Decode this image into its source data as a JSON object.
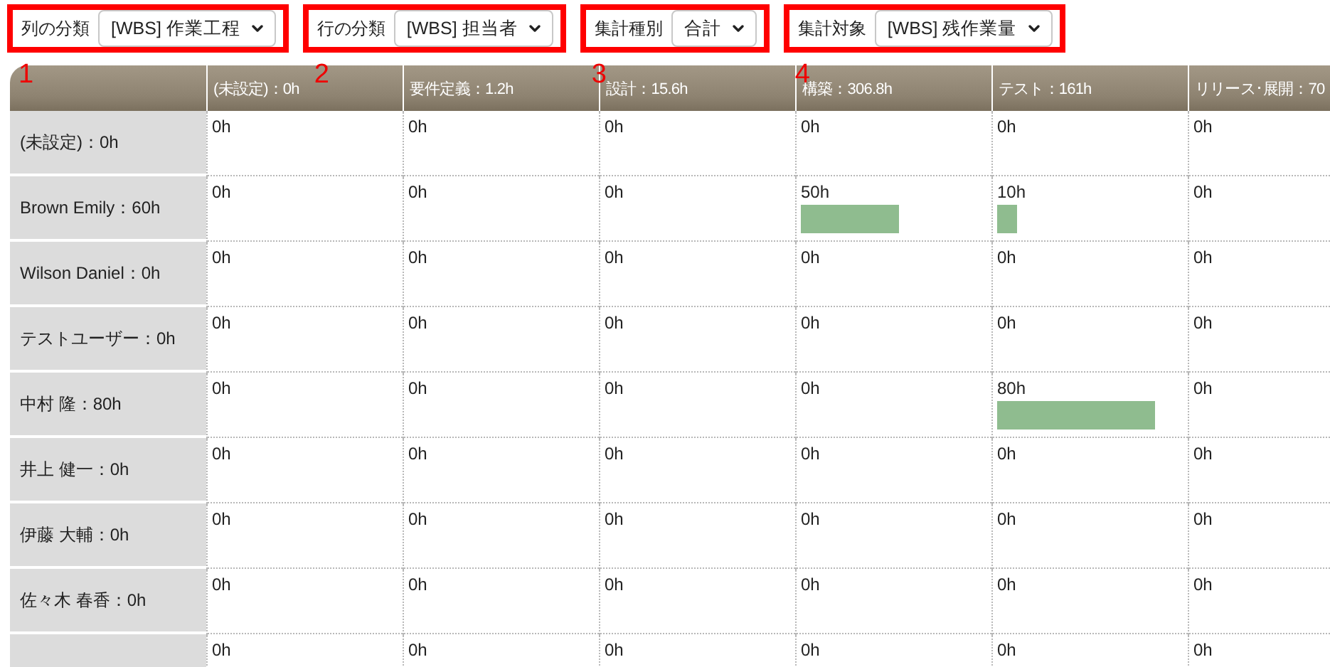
{
  "filters": [
    {
      "label": "列の分類",
      "value": "[WBS] 作業工程",
      "marker": "1"
    },
    {
      "label": "行の分類",
      "value": "[WBS] 担当者",
      "marker": "2"
    },
    {
      "label": "集計種別",
      "value": "合計",
      "marker": "3"
    },
    {
      "label": "集計対象",
      "value": "[WBS] 残作業量",
      "marker": "4"
    }
  ],
  "table": {
    "columns": [
      "(未設定)：0h",
      "要件定義：1.2h",
      "設計：15.6h",
      "構築：306.8h",
      "テスト：161h",
      "リリース･展開：70"
    ],
    "rows": [
      {
        "label": "(未設定)：0h",
        "cells": [
          {
            "value": "0h"
          },
          {
            "value": "0h"
          },
          {
            "value": "0h"
          },
          {
            "value": "0h"
          },
          {
            "value": "0h"
          },
          {
            "value": "0h"
          }
        ]
      },
      {
        "label": "Brown Emily：60h",
        "cells": [
          {
            "value": "0h"
          },
          {
            "value": "0h"
          },
          {
            "value": "0h"
          },
          {
            "value": "50h",
            "level": 0.53
          },
          {
            "value": "10h",
            "level": 0.11
          },
          {
            "value": "0h"
          }
        ]
      },
      {
        "label": "Wilson Daniel：0h",
        "cells": [
          {
            "value": "0h"
          },
          {
            "value": "0h"
          },
          {
            "value": "0h"
          },
          {
            "value": "0h"
          },
          {
            "value": "0h"
          },
          {
            "value": "0h"
          }
        ]
      },
      {
        "label": "テストユーザー：0h",
        "cells": [
          {
            "value": "0h"
          },
          {
            "value": "0h"
          },
          {
            "value": "0h"
          },
          {
            "value": "0h"
          },
          {
            "value": "0h"
          },
          {
            "value": "0h"
          }
        ]
      },
      {
        "label": "中村 隆：80h",
        "cells": [
          {
            "value": "0h"
          },
          {
            "value": "0h"
          },
          {
            "value": "0h"
          },
          {
            "value": "0h"
          },
          {
            "value": "80h",
            "level": 0.85
          },
          {
            "value": "0h"
          }
        ]
      },
      {
        "label": "井上 健一：0h",
        "cells": [
          {
            "value": "0h"
          },
          {
            "value": "0h"
          },
          {
            "value": "0h"
          },
          {
            "value": "0h"
          },
          {
            "value": "0h"
          },
          {
            "value": "0h"
          }
        ]
      },
      {
        "label": "伊藤 大輔：0h",
        "cells": [
          {
            "value": "0h"
          },
          {
            "value": "0h"
          },
          {
            "value": "0h"
          },
          {
            "value": "0h"
          },
          {
            "value": "0h"
          },
          {
            "value": "0h"
          }
        ]
      },
      {
        "label": "佐々木 春香：0h",
        "cells": [
          {
            "value": "0h"
          },
          {
            "value": "0h"
          },
          {
            "value": "0h"
          },
          {
            "value": "0h"
          },
          {
            "value": "0h"
          },
          {
            "value": "0h"
          }
        ]
      },
      {
        "cells": [
          {
            "value": "0h"
          },
          {
            "value": "0h"
          },
          {
            "value": "0h"
          },
          {
            "value": "0h"
          },
          {
            "value": "0h"
          },
          {
            "value": "0h"
          }
        ]
      }
    ]
  }
}
